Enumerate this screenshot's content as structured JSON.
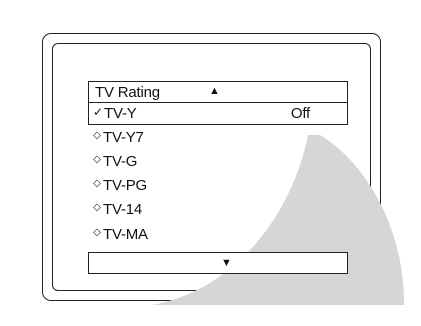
{
  "menu": {
    "title": "TV Rating",
    "scroll_up_icon": "▲",
    "scroll_down_icon": "▼",
    "items": [
      {
        "mark": "✓",
        "label": "TV-Y",
        "value": "Off",
        "selected": true
      },
      {
        "mark": "◇",
        "label": "TV-Y7",
        "value": "",
        "selected": false
      },
      {
        "mark": "◇",
        "label": "TV-G",
        "value": "",
        "selected": false
      },
      {
        "mark": "◇",
        "label": "TV-PG",
        "value": "",
        "selected": false
      },
      {
        "mark": "◇",
        "label": "TV-14",
        "value": "",
        "selected": false
      },
      {
        "mark": "◇",
        "label": "TV-MA",
        "value": "",
        "selected": false
      }
    ]
  },
  "colors": {
    "frame": "#222222",
    "shadow": "#d6d6d6",
    "background": "#ffffff"
  }
}
